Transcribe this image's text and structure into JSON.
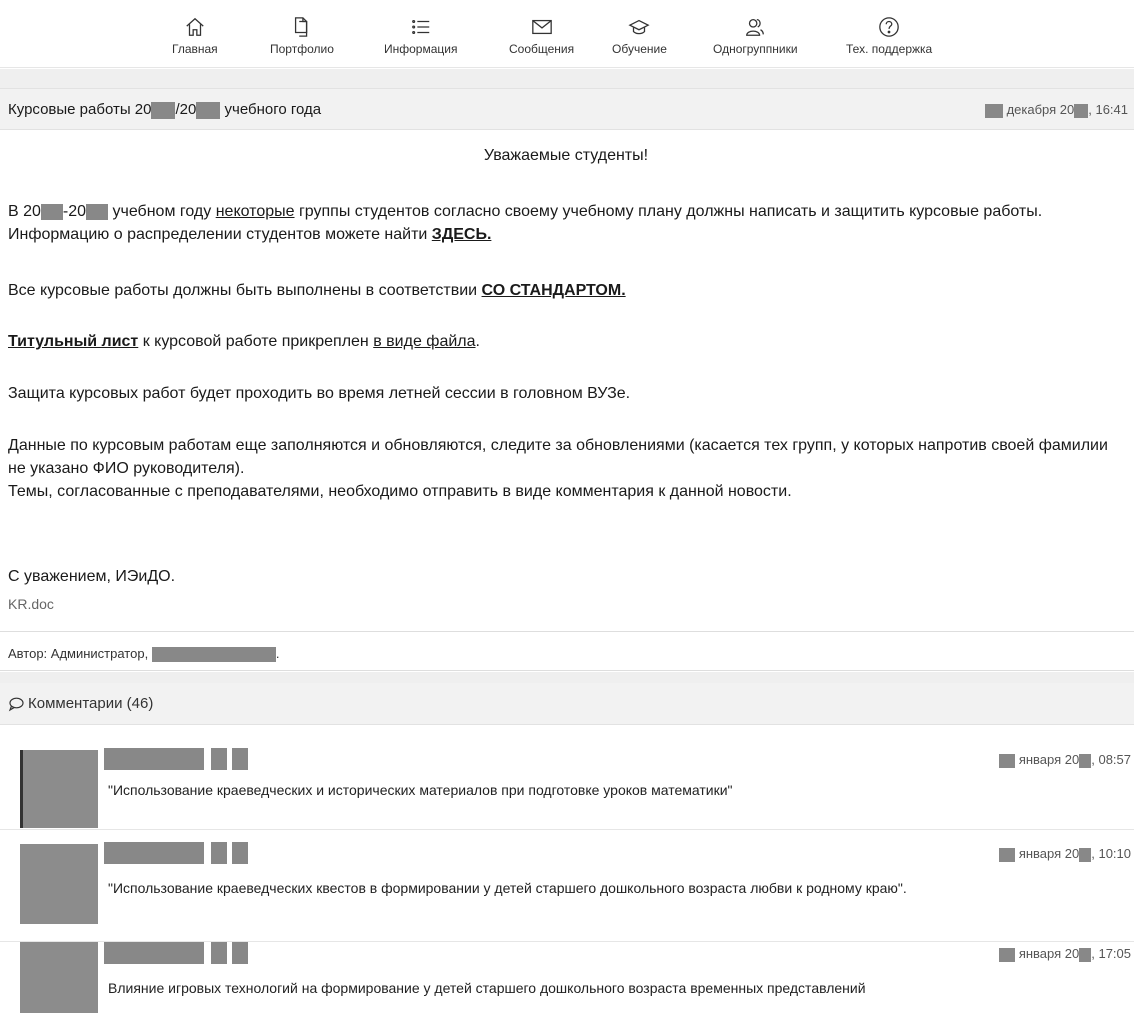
{
  "nav": {
    "items": [
      {
        "label": "Главная",
        "icon": "home-icon"
      },
      {
        "label": "Портфолио",
        "icon": "documents-icon"
      },
      {
        "label": "Информация",
        "icon": "list-icon"
      },
      {
        "label": "Сообщения",
        "icon": "envelope-icon"
      },
      {
        "label": "Обучение",
        "icon": "graduation-cap-icon"
      },
      {
        "label": "Одногруппники",
        "icon": "users-icon"
      },
      {
        "label": "Тех. поддержка",
        "icon": "help-icon"
      }
    ]
  },
  "news": {
    "title_part1": "Курсовые работы 20",
    "title_part2": "/20",
    "title_part3": "учебного года",
    "date_part": "декабря 20",
    "time": ", 16:41",
    "greeting": "Уважаемые студенты!",
    "p1_a": "В 20",
    "p1_b": "-20",
    "p1_c": " учебном году ",
    "p1_link": "некоторые",
    "p1_d": " группы студентов согласно своему учебному плану должны написать и защитить курсовые работы. Информацию о распределении студентов можете найти ",
    "p1_here": "ЗДЕСЬ.",
    "p2_a": "Все курсовые работы должны быть выполнены в соответствии ",
    "p2_link": "СО СТАНДАРТОМ.",
    "p3_link1": "Титульный лист",
    "p3_a": " к курсовой работе прикреплен ",
    "p3_link2": "в виде файла",
    "p3_b": ".",
    "p4": "Защита курсовых работ будет проходить во время летней сессии в головном ВУЗе.",
    "p5a": "Данные по курсовым работам еще заполняются и обновляются, следите за обновлениями (касается тех групп, у которых напротив своей фамилии не указано ФИО руководителя).",
    "p5b": "Темы, согласованные с преподавателями, необходимо отправить в виде комментария к данной новости.",
    "signature": "С уважением, ИЭиДО.",
    "attachment": "KR.doc",
    "author_label": "Автор: Администратор, ",
    "author_end": "."
  },
  "comments": {
    "title": "Комментарии (46)",
    "items": [
      {
        "date": "января 20",
        "time": ", 08:57",
        "text": "\"Использование краеведческих и исторических материалов при подготовке уроков математики\""
      },
      {
        "date": "января 20",
        "time": ", 10:10",
        "text": "\"Использование краеведческих квестов в формировании у детей старшего дошкольного возраста любви к родному краю\"."
      },
      {
        "date": "января 20",
        "time": ", 17:05",
        "text": "Влияние игровых технологий на формирование у детей старшего дошкольного возраста временных представлений"
      }
    ]
  }
}
